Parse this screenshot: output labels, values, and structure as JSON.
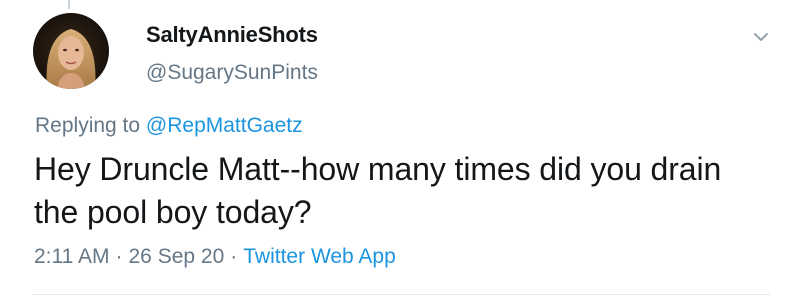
{
  "tweet": {
    "author": {
      "display_name": "SaltyAnnieShots",
      "handle": "@SugarySunPints",
      "avatar_icon": "profile-photo"
    },
    "reply": {
      "prefix": "Replying to ",
      "mention": "@RepMattGaetz"
    },
    "text": "Hey Druncle Matt--how many times did you drain the pool boy today?",
    "meta": {
      "time": "2:11 AM",
      "separator": "·",
      "date": "26 Sep 20",
      "source": "Twitter Web App"
    },
    "menu_icon": "chevron-down-icon"
  },
  "colors": {
    "text_primary": "#14171a",
    "text_secondary": "#657786",
    "link": "#1b95e0",
    "divider": "#e1e8ed"
  }
}
